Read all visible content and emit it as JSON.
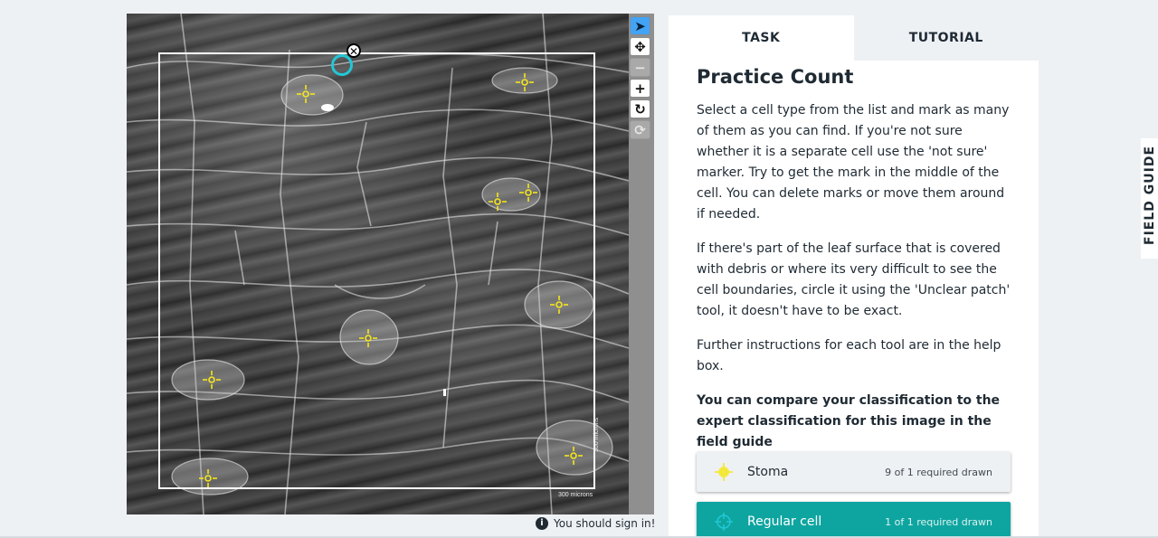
{
  "viewer": {
    "scale_label_horizontal": "300 microns",
    "scale_label_vertical": "300 microns",
    "markers": [
      {
        "type": "stoma",
        "icon": "stoma-marker-icon"
      },
      {
        "type": "stoma",
        "icon": "stoma-marker-icon"
      },
      {
        "type": "stoma",
        "icon": "stoma-marker-icon"
      },
      {
        "type": "stoma",
        "icon": "stoma-marker-icon"
      },
      {
        "type": "stoma",
        "icon": "stoma-marker-icon"
      },
      {
        "type": "stoma",
        "icon": "stoma-marker-icon"
      },
      {
        "type": "stoma",
        "icon": "stoma-marker-icon"
      },
      {
        "type": "stoma",
        "icon": "stoma-marker-icon"
      },
      {
        "type": "stoma",
        "icon": "stoma-marker-icon"
      }
    ],
    "marker_color": "#f5e61a",
    "regular_cell_marker_color": "#22c7d6"
  },
  "toolbar": {
    "tools": [
      {
        "name": "select-tool",
        "icon": "pointer-icon",
        "glyph": "➤",
        "state": "active"
      },
      {
        "name": "pan-tool",
        "icon": "move-icon",
        "glyph": "✥",
        "state": "normal"
      },
      {
        "name": "zoom-out-tool",
        "icon": "minus-icon",
        "glyph": "−",
        "state": "disabled"
      },
      {
        "name": "zoom-in-tool",
        "icon": "plus-icon",
        "glyph": "+",
        "state": "normal"
      },
      {
        "name": "rotate-tool",
        "icon": "rotate-icon",
        "glyph": "↻",
        "state": "normal"
      },
      {
        "name": "reset-tool",
        "icon": "reset-icon",
        "glyph": "⟳",
        "state": "disabled"
      }
    ],
    "signin_text": "You should sign in!",
    "signin_icon": "info-icon"
  },
  "panel": {
    "tabs": [
      {
        "label": "TASK",
        "selected": true
      },
      {
        "label": "TUTORIAL",
        "selected": false
      }
    ],
    "title": "Practice Count",
    "paragraphs": [
      "Select a cell type from the list and mark as many of them as you can find. If you're not sure whether it is a separate cell use the 'not sure' marker. Try to get the mark in the middle of the cell. You can delete marks or move them around if needed.",
      "If there's part of the leaf surface that is covered with debris or where its very difficult to see the cell boundaries, circle it using the 'Unclear patch' tool, it doesn't have to be exact.",
      "Further instructions for each tool are in the help box."
    ],
    "bold_note": "You can compare your classification to the expert classification for this image in the field guide",
    "answers": [
      {
        "label": "Stoma",
        "count": "9 of 1 required drawn",
        "icon": "crosshair-dot-icon",
        "color": "#f5e61a"
      },
      {
        "label": "Regular cell",
        "count": "1 of 1 required drawn",
        "icon": "crosshair-icon",
        "color": "#22c7d6"
      }
    ]
  },
  "field_guide": {
    "label": "FIELD GUIDE"
  },
  "colors": {
    "accent_teal": "#0ea5a0",
    "active_tool": "#43a3f5",
    "background": "#eef1f4"
  }
}
